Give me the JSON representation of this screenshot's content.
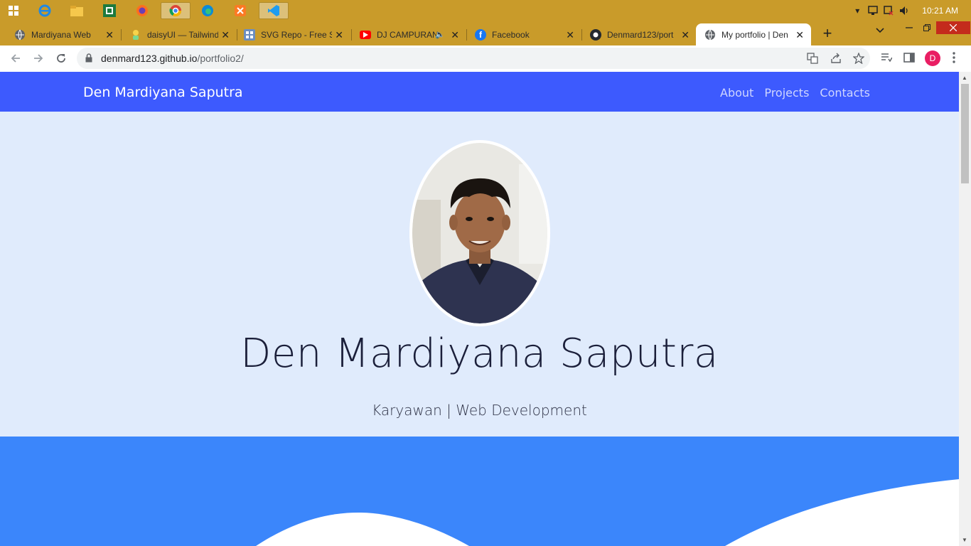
{
  "taskbar": {
    "apps": [
      "windows-start",
      "internet-explorer",
      "file-explorer",
      "excel",
      "firefox",
      "chrome",
      "edge",
      "xampp",
      "vscode"
    ],
    "clock": "10:21 AM"
  },
  "browser": {
    "tabs": [
      {
        "title": "Mardiyana Web",
        "favicon": "globe-icon"
      },
      {
        "title": "daisyUI — Tailwind",
        "favicon": "daisyui-icon"
      },
      {
        "title": "SVG Repo - Free S",
        "favicon": "svgrepo-icon"
      },
      {
        "title": "DJ CAMPURAN",
        "favicon": "youtube-icon"
      },
      {
        "title": "Facebook",
        "favicon": "facebook-icon"
      },
      {
        "title": "Denmard123/port",
        "favicon": "github-icon"
      },
      {
        "title": "My portfolio | Den",
        "favicon": "globe-icon"
      }
    ],
    "url_host": "denmard123.github.io",
    "url_path": "/portfolio2/",
    "profile_initial": "D",
    "colors": {
      "frame": "#c99b2a",
      "profile": "#e91e63"
    }
  },
  "site": {
    "brand": "Den Mardiyana Saputra",
    "menu": [
      "About",
      "Projects",
      "Contacts"
    ],
    "hero_title": "Den Mardiyana Saputra",
    "hero_subtitle": "Karyawan | Web Development",
    "colors": {
      "nav": "#3d5afe",
      "hero_bg": "#e0ebfc",
      "band": "#3b86fb"
    }
  }
}
